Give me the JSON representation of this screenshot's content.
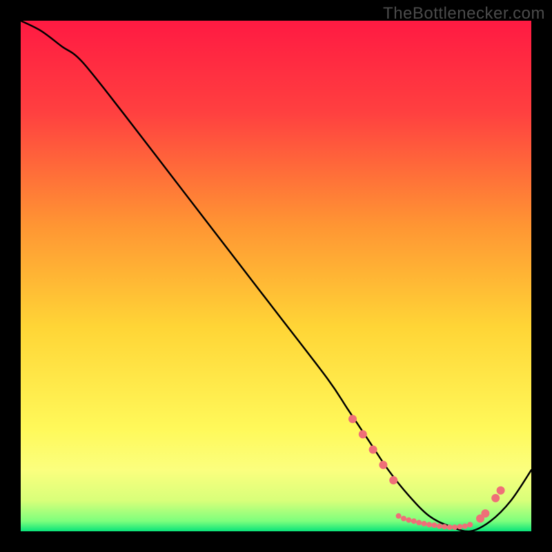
{
  "watermark": "TheBottlenecker.com",
  "chart_data": {
    "type": "line",
    "title": "",
    "xlabel": "",
    "ylabel": "",
    "xlim": [
      0,
      100
    ],
    "ylim": [
      0,
      100
    ],
    "gradient_stops": [
      {
        "pct": 0,
        "color": "#ff1a42"
      },
      {
        "pct": 18,
        "color": "#ff4040"
      },
      {
        "pct": 40,
        "color": "#ff9533"
      },
      {
        "pct": 60,
        "color": "#ffd536"
      },
      {
        "pct": 80,
        "color": "#fff95a"
      },
      {
        "pct": 88,
        "color": "#fbff7e"
      },
      {
        "pct": 94,
        "color": "#d8ff7a"
      },
      {
        "pct": 98,
        "color": "#7dff7d"
      },
      {
        "pct": 100,
        "color": "#09e37a"
      }
    ],
    "series": [
      {
        "name": "bottleneck-curve",
        "x": [
          0,
          4,
          8,
          12,
          20,
          30,
          40,
          50,
          60,
          64,
          68,
          72,
          76,
          80,
          84,
          88,
          92,
          96,
          100
        ],
        "y": [
          100,
          98,
          95,
          92,
          82,
          69,
          56,
          43,
          30,
          24,
          18,
          12,
          7,
          3,
          1,
          0,
          2,
          6,
          12
        ]
      }
    ],
    "markers": {
      "name": "highlight-points",
      "color": "#ef6f78",
      "radius_big": 6,
      "radius_small": 4,
      "points": [
        {
          "x": 65,
          "y": 22,
          "r": "big"
        },
        {
          "x": 67,
          "y": 19,
          "r": "big"
        },
        {
          "x": 69,
          "y": 16,
          "r": "big"
        },
        {
          "x": 71,
          "y": 13,
          "r": "big"
        },
        {
          "x": 73,
          "y": 10,
          "r": "big"
        },
        {
          "x": 74,
          "y": 3,
          "r": "small"
        },
        {
          "x": 75,
          "y": 2.5,
          "r": "small"
        },
        {
          "x": 76,
          "y": 2.2,
          "r": "small"
        },
        {
          "x": 77,
          "y": 2,
          "r": "small"
        },
        {
          "x": 78,
          "y": 1.7,
          "r": "small"
        },
        {
          "x": 79,
          "y": 1.5,
          "r": "small"
        },
        {
          "x": 80,
          "y": 1.3,
          "r": "small"
        },
        {
          "x": 81,
          "y": 1.2,
          "r": "small"
        },
        {
          "x": 82,
          "y": 1.0,
          "r": "small"
        },
        {
          "x": 83,
          "y": 0.9,
          "r": "small"
        },
        {
          "x": 84,
          "y": 0.8,
          "r": "small"
        },
        {
          "x": 85,
          "y": 0.8,
          "r": "small"
        },
        {
          "x": 86,
          "y": 0.9,
          "r": "small"
        },
        {
          "x": 87,
          "y": 1.0,
          "r": "small"
        },
        {
          "x": 88,
          "y": 1.3,
          "r": "small"
        },
        {
          "x": 90,
          "y": 2.5,
          "r": "big"
        },
        {
          "x": 91,
          "y": 3.5,
          "r": "big"
        },
        {
          "x": 93,
          "y": 6.5,
          "r": "big"
        },
        {
          "x": 94,
          "y": 8,
          "r": "big"
        }
      ]
    }
  }
}
